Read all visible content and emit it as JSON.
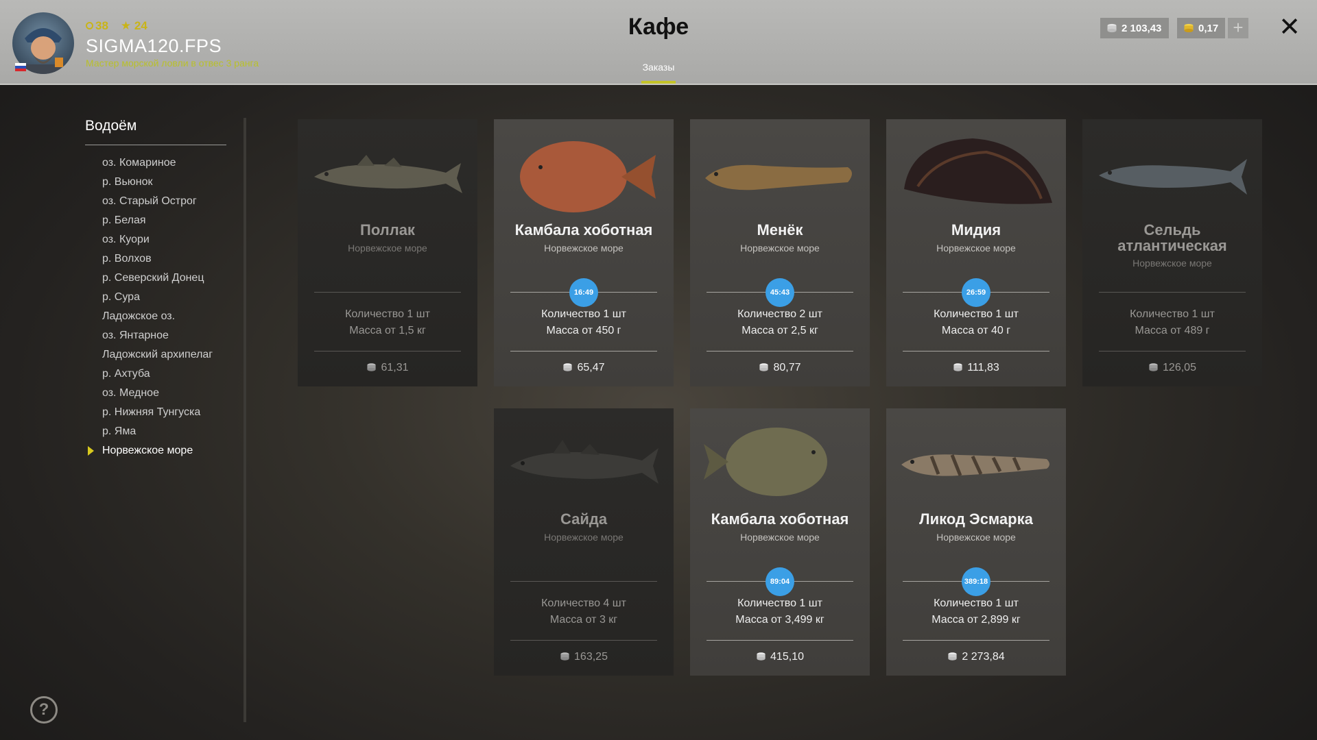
{
  "header": {
    "title": "Кафе",
    "tab": "Заказы",
    "player": {
      "level": "38",
      "rank": "24",
      "name": "SIGMA120.FPS",
      "subtitle": "Мастер морской ловли в отвес 3 ранга"
    },
    "silver": "2 103,43",
    "gold": "0,17",
    "plus": "+",
    "close": "✕"
  },
  "sidebar": {
    "title": "Водоём",
    "items": [
      "оз. Комариное",
      "р. Вьюнок",
      "оз. Старый Острог",
      "р. Белая",
      "оз. Куори",
      "р. Волхов",
      "р. Северский Донец",
      "р. Сура",
      "Ладожское оз.",
      "оз. Янтарное",
      "Ладожский архипелаг",
      "р. Ахтуба",
      "оз. Медное",
      "р. Нижняя Тунгуска",
      "р. Яма",
      "Норвежское море"
    ],
    "active_index": 15
  },
  "help": "?",
  "cards": [
    {
      "name": "Поллак",
      "region": "Норвежское море",
      "timer": "",
      "qty": "Количество 1 шт",
      "mass": "Масса от 1,5 кг",
      "price": "61,31",
      "active": false
    },
    {
      "name": "Камбала хоботная",
      "region": "Норвежское море",
      "timer": "16:49",
      "qty": "Количество 1 шт",
      "mass": "Масса от 450 г",
      "price": "65,47",
      "active": true
    },
    {
      "name": "Менёк",
      "region": "Норвежское море",
      "timer": "45:43",
      "qty": "Количество 2 шт",
      "mass": "Масса от 2,5 кг",
      "price": "80,77",
      "active": true
    },
    {
      "name": "Мидия",
      "region": "Норвежское море",
      "timer": "26:59",
      "qty": "Количество 1 шт",
      "mass": "Масса от 40 г",
      "price": "111,83",
      "active": true
    },
    {
      "name": "Сельдь атлантическая",
      "region": "Норвежское море",
      "timer": "",
      "qty": "Количество 1 шт",
      "mass": "Масса от 489 г",
      "price": "126,05",
      "active": false
    },
    {
      "name": "Сайда",
      "region": "Норвежское море",
      "timer": "",
      "qty": "Количество 4 шт",
      "mass": "Масса от 3 кг",
      "price": "163,25",
      "active": false
    },
    {
      "name": "Камбала хоботная",
      "region": "Норвежское море",
      "timer": "89:04",
      "qty": "Количество 1 шт",
      "mass": "Масса от 3,499 кг",
      "price": "415,10",
      "active": true
    },
    {
      "name": "Ликод Эсмарка",
      "region": "Норвежское море",
      "timer": "389:18",
      "qty": "Количество 1 шт",
      "mass": "Масса от 2,899 кг",
      "price": "2 273,84",
      "active": true
    }
  ]
}
